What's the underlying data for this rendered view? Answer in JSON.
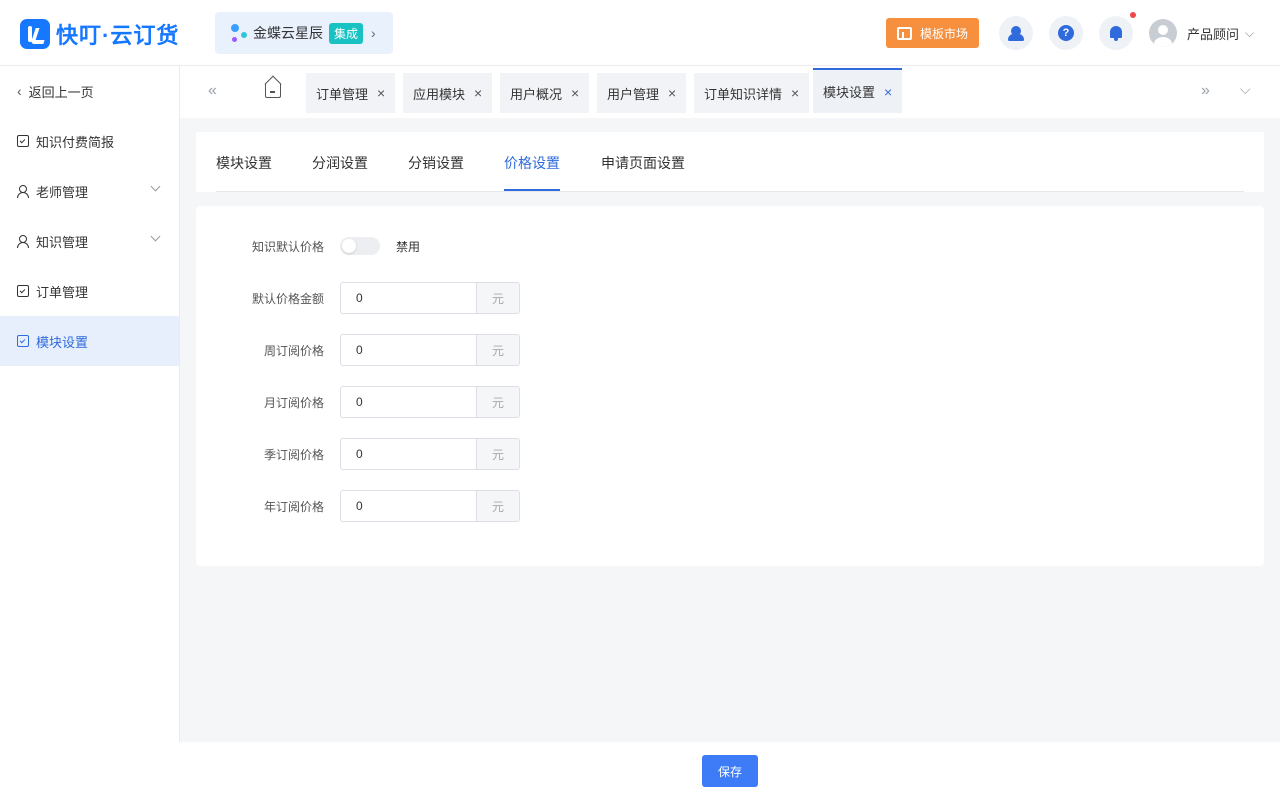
{
  "header": {
    "logo_text": "快叮·云订货",
    "integration": {
      "name": "金蝶云星辰",
      "badge": "集成",
      "chevron": "›"
    },
    "template_market": "模板市场",
    "help_glyph": "?",
    "user_name": "产品顾问",
    "user_chevron": "⌵"
  },
  "sidebar": {
    "items": [
      {
        "label": "返回上一页"
      },
      {
        "label": "知识付费简报"
      },
      {
        "label": "老师管理"
      },
      {
        "label": "知识管理"
      },
      {
        "label": "订单管理"
      },
      {
        "label": "模块设置"
      }
    ],
    "back_glyph": "‹"
  },
  "tabs_bar": {
    "prev_glyph": "«",
    "next_glyph": "»",
    "more_glyph": "⌵",
    "close_glyph": "×",
    "tabs": [
      {
        "label": "订单管理"
      },
      {
        "label": "应用模块"
      },
      {
        "label": "用户概况"
      },
      {
        "label": "用户管理"
      },
      {
        "label": "订单知识详情"
      },
      {
        "label": "模块设置"
      }
    ]
  },
  "subtabs": [
    {
      "label": "模块设置"
    },
    {
      "label": "分润设置"
    },
    {
      "label": "分销设置"
    },
    {
      "label": "价格设置"
    },
    {
      "label": "申请页面设置"
    }
  ],
  "form": {
    "default_price_label": "知识默认价格",
    "default_price_status": "禁用",
    "fields": [
      {
        "label": "默认价格金额",
        "value": "0",
        "unit": "元"
      },
      {
        "label": "周订阅价格",
        "value": "0",
        "unit": "元"
      },
      {
        "label": "月订阅价格",
        "value": "0",
        "unit": "元"
      },
      {
        "label": "季订阅价格",
        "value": "0",
        "unit": "元"
      },
      {
        "label": "年订阅价格",
        "value": "0",
        "unit": "元"
      }
    ]
  },
  "footer": {
    "save_label": "保存"
  },
  "colors": {
    "primary": "#2f6bdc",
    "accent_orange": "#f7903e",
    "badge_teal": "#19c2c2"
  }
}
